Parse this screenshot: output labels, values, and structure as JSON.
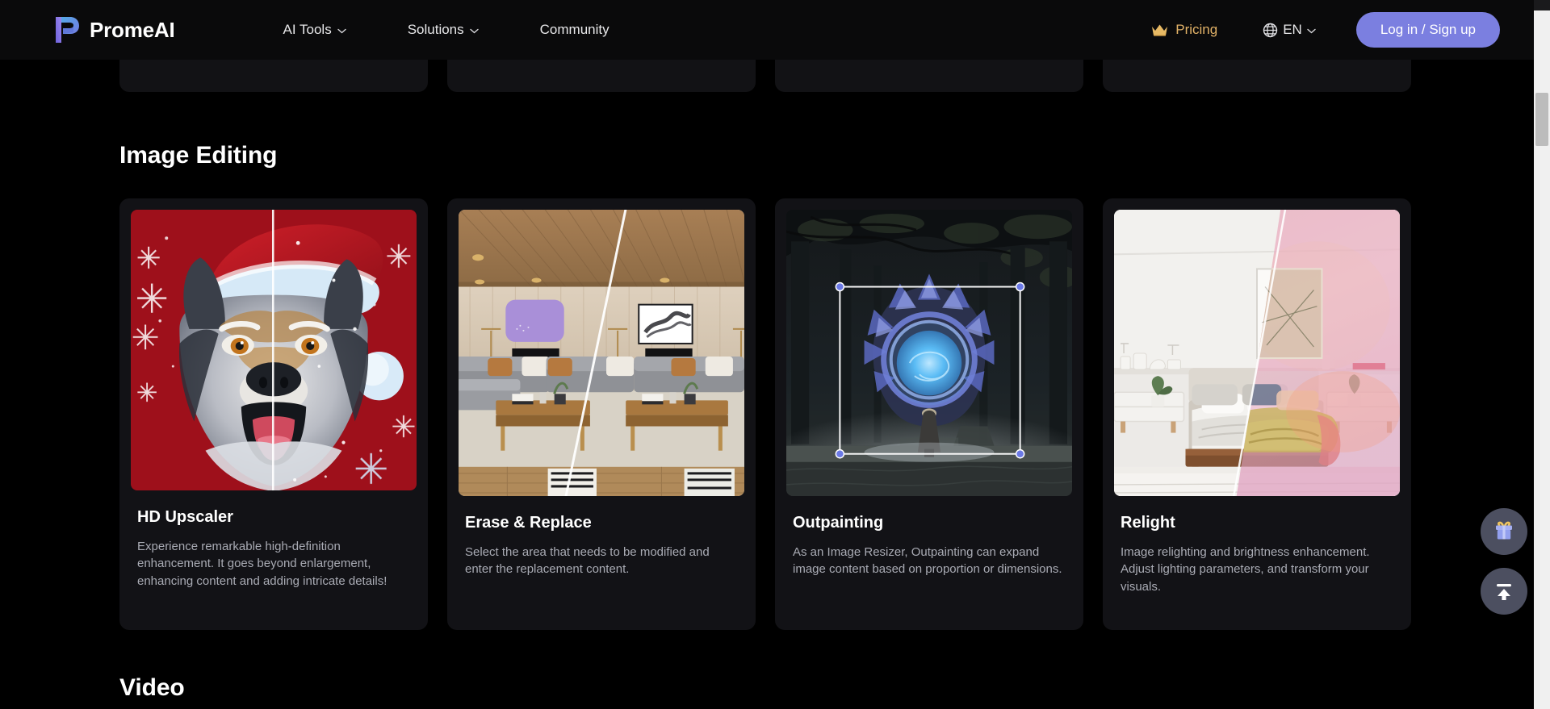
{
  "header": {
    "brand": "PromeAI",
    "brand_logo_icon": "promeai-logo-icon",
    "nav": [
      {
        "label": "AI Tools",
        "has_chevron": true
      },
      {
        "label": "Solutions",
        "has_chevron": true
      },
      {
        "label": "Community",
        "has_chevron": false
      }
    ],
    "pricing": {
      "label": "Pricing",
      "icon": "crown-icon",
      "color": "#e3b368"
    },
    "language": {
      "label": "EN",
      "icon": "globe-icon",
      "has_chevron": true
    },
    "login_button": {
      "label": "Log in / Sign up",
      "color": "#7b7fe0"
    }
  },
  "sections": [
    {
      "heading": "Image Editing",
      "cards": [
        {
          "title": "HD Upscaler",
          "desc": "Experience remarkable high-definition enhancement. It goes beyond enlargement, enhancing content and adding intricate details!",
          "media": "husky-santa-hat-before-after"
        },
        {
          "title": "Erase & Replace",
          "desc": "Select the area that needs to be modified and enter the replacement content.",
          "media": "living-room-mask-replace"
        },
        {
          "title": "Outpainting",
          "desc": "As an Image Resizer, Outpainting can expand image content based on proportion or dimensions.",
          "media": "forest-portal-crop-box"
        },
        {
          "title": "Relight",
          "desc": "Image relighting and brightness enhancement. Adjust lighting parameters, and transform your visuals.",
          "media": "bedroom-relight-before-after"
        }
      ]
    },
    {
      "heading": "Video",
      "cards": []
    }
  ],
  "floating_buttons": [
    {
      "name": "gift-icon",
      "label": "Gift"
    },
    {
      "name": "scroll-to-top-icon",
      "label": "Back to top"
    }
  ],
  "scrollbar": {
    "position_percent": 14
  },
  "colors": {
    "background": "#000000",
    "header_bg": "#0a0a0b",
    "card_bg": "#121216",
    "accent": "#7b7fe0",
    "gold": "#e3b368",
    "text_primary": "#ffffff",
    "text_secondary": "#a9abb4"
  }
}
